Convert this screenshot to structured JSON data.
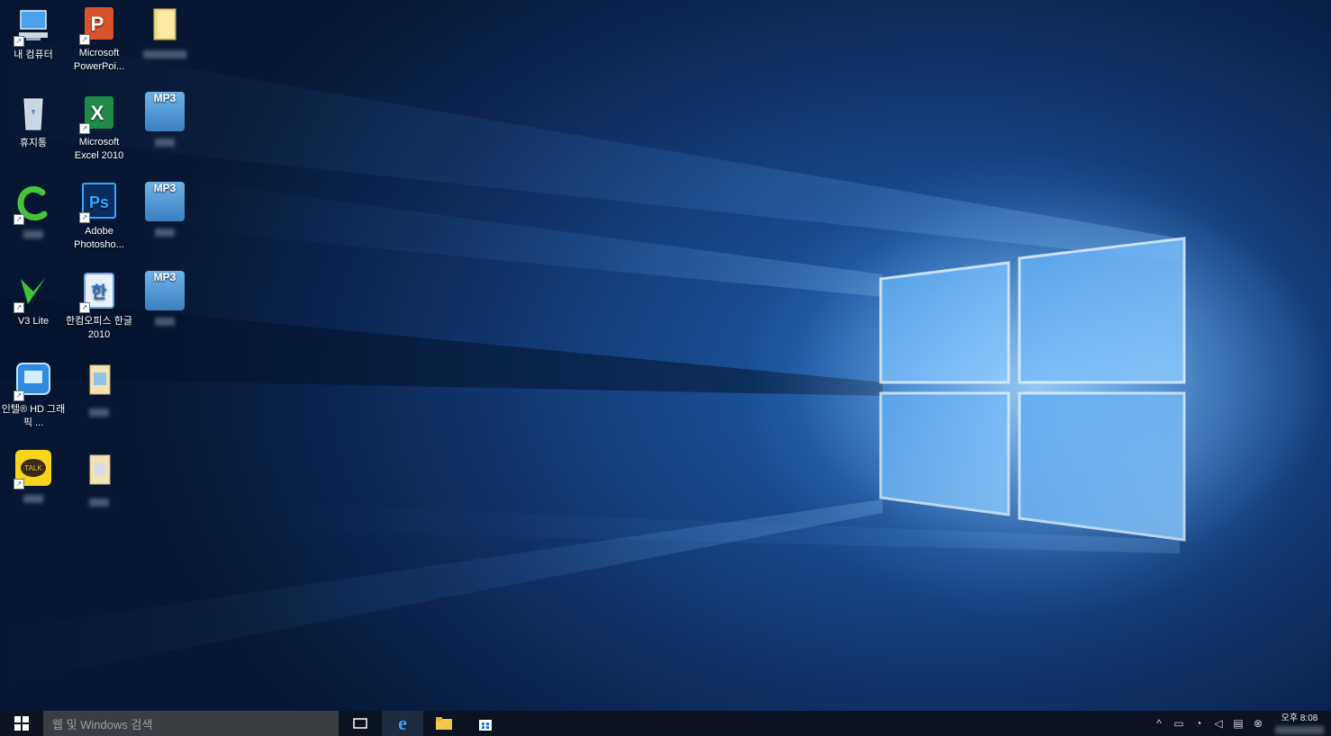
{
  "desktop": {
    "icons": [
      {
        "id": "my-computer",
        "label": "내 컴퓨터"
      },
      {
        "id": "powerpoint",
        "label": "Microsoft PowerPoi..."
      },
      {
        "id": "recycle-bin",
        "label": "휴지통"
      },
      {
        "id": "excel",
        "label": "Microsoft Excel 2010"
      },
      {
        "id": "mp3-1",
        "glyph": "MP3"
      },
      {
        "id": "mp3-2",
        "glyph": "MP3"
      },
      {
        "id": "mp3-3",
        "glyph": "MP3"
      },
      {
        "id": "photoshop",
        "label": "Adobe Photosho..."
      },
      {
        "id": "v3-lite",
        "label": "V3 Lite"
      },
      {
        "id": "hwp",
        "label": "한컴오피스 한글 2010"
      },
      {
        "id": "intel-hd",
        "label": "인텔® HD 그래픽 ..."
      },
      {
        "id": "kakaotalk",
        "glyph": "TALK"
      }
    ]
  },
  "taskbar": {
    "search_placeholder": "웹 및 Windows 검색",
    "clock_time": "오후 8:08"
  },
  "colors": {
    "taskbar": "#0b1320",
    "search_box": "#3a3d42",
    "accent": "#1f6fd6"
  }
}
